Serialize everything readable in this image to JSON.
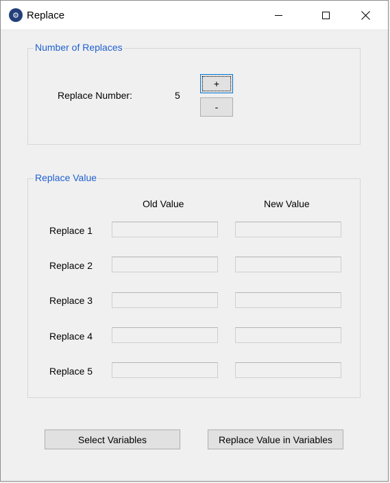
{
  "window": {
    "title": "Replace",
    "icon": "app-gear-icon"
  },
  "number_group": {
    "legend": "Number of Replaces",
    "label": "Replace Number:",
    "value": "5",
    "plus_label": "+",
    "minus_label": "-"
  },
  "value_group": {
    "legend": "Replace Value",
    "old_header": "Old Value",
    "new_header": "New Value",
    "rows": [
      {
        "label": "Replace 1",
        "old": "",
        "new": ""
      },
      {
        "label": "Replace 2",
        "old": "",
        "new": ""
      },
      {
        "label": "Replace 3",
        "old": "",
        "new": ""
      },
      {
        "label": "Replace 4",
        "old": "",
        "new": ""
      },
      {
        "label": "Replace 5",
        "old": "",
        "new": ""
      }
    ]
  },
  "buttons": {
    "select": "Select Variables",
    "replace": "Replace Value in Variables"
  },
  "colors": {
    "accent": "#1e5fd0",
    "window_bg": "#f0f0f0"
  }
}
